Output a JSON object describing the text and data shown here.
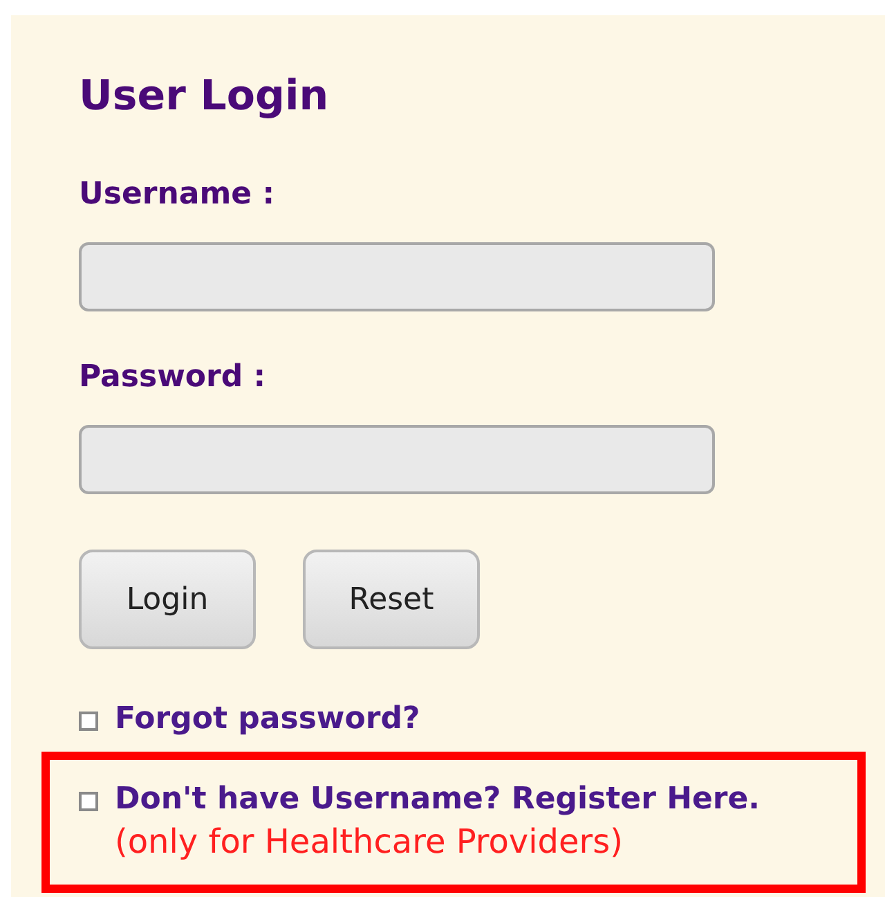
{
  "title": "User Login",
  "fields": [
    {
      "label": "Username :"
    },
    {
      "label": "Password :"
    }
  ],
  "buttons": [
    "Login",
    "Reset"
  ],
  "links": [
    {
      "text": "Forgot password?",
      "highlighted": false
    },
    {
      "text": "Don't have Username? Register Here.",
      "note": "(only for Healthcare Providers)",
      "highlighted": true
    }
  ]
}
